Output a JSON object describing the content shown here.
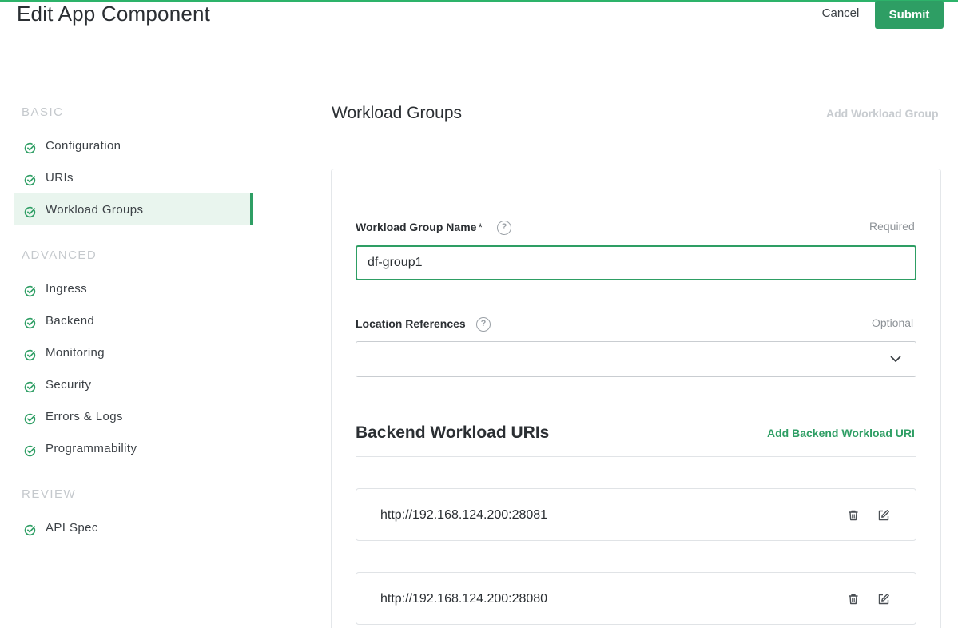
{
  "header": {
    "title": "Edit App Component",
    "cancel_label": "Cancel",
    "submit_label": "Submit"
  },
  "sidebar": {
    "sections": [
      {
        "heading": "BASIC",
        "items": [
          {
            "label": "Configuration",
            "icon": "check-circle-icon"
          },
          {
            "label": "URIs",
            "icon": "check-circle-icon"
          },
          {
            "label": "Workload Groups",
            "icon": "check-circle-icon",
            "active": true
          }
        ]
      },
      {
        "heading": "ADVANCED",
        "items": [
          {
            "label": "Ingress",
            "icon": "check-circle-icon"
          },
          {
            "label": "Backend",
            "icon": "check-circle-icon"
          },
          {
            "label": "Monitoring",
            "icon": "check-circle-icon"
          },
          {
            "label": "Security",
            "icon": "check-circle-icon"
          },
          {
            "label": "Errors & Logs",
            "icon": "check-circle-icon"
          },
          {
            "label": "Programmability",
            "icon": "check-circle-icon"
          }
        ]
      },
      {
        "heading": "REVIEW",
        "items": [
          {
            "label": "API Spec",
            "icon": "check-circle-icon"
          }
        ]
      }
    ]
  },
  "main": {
    "heading": "Workload Groups",
    "add_workload_group_label": "Add Workload Group",
    "form": {
      "name_label": "Workload Group Name",
      "name_required_mark": "*",
      "name_hint": "Required",
      "name_value": "df-group1",
      "location_label": "Location References",
      "location_hint": "Optional",
      "location_value": ""
    },
    "backend": {
      "heading": "Backend Workload URIs",
      "add_label": "Add Backend Workload URI",
      "uris": [
        "http://192.168.124.200:28081",
        "http://192.168.124.200:28080"
      ]
    }
  },
  "colors": {
    "accent": "#2e9e64",
    "top_bar": "#2db36a",
    "active_nav_bg": "#e9f5ee",
    "muted": "#c8ccd0"
  }
}
